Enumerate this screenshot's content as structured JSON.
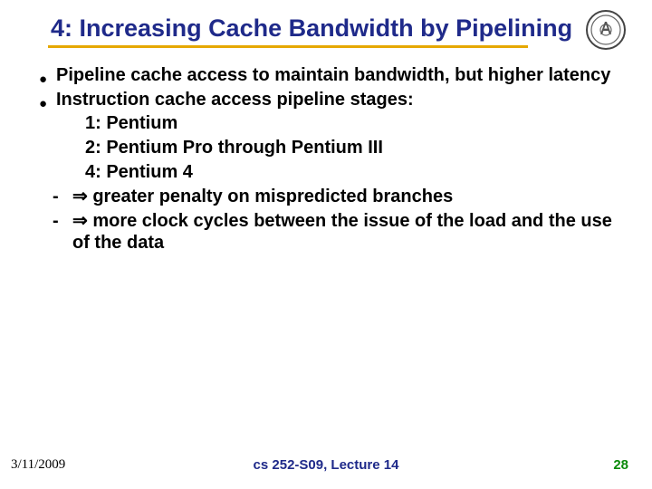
{
  "header": {
    "title": "4: Increasing Cache Bandwidth by Pipelining"
  },
  "body": {
    "b1": "Pipeline cache access to maintain bandwidth, but higher latency",
    "b2": "Instruction cache access pipeline stages:",
    "s1": "1: Pentium",
    "s2": "2: Pentium Pro through Pentium III",
    "s3": "4: Pentium 4",
    "d1_arrow": "⇒",
    "d1": "greater penalty on mispredicted branches",
    "d2_arrow": "⇒",
    "d2": "more clock cycles between the issue of the load and the use of the data"
  },
  "footer": {
    "date": "3/11/2009",
    "course": "cs 252-S09, Lecture 14",
    "pagenum": "28"
  }
}
